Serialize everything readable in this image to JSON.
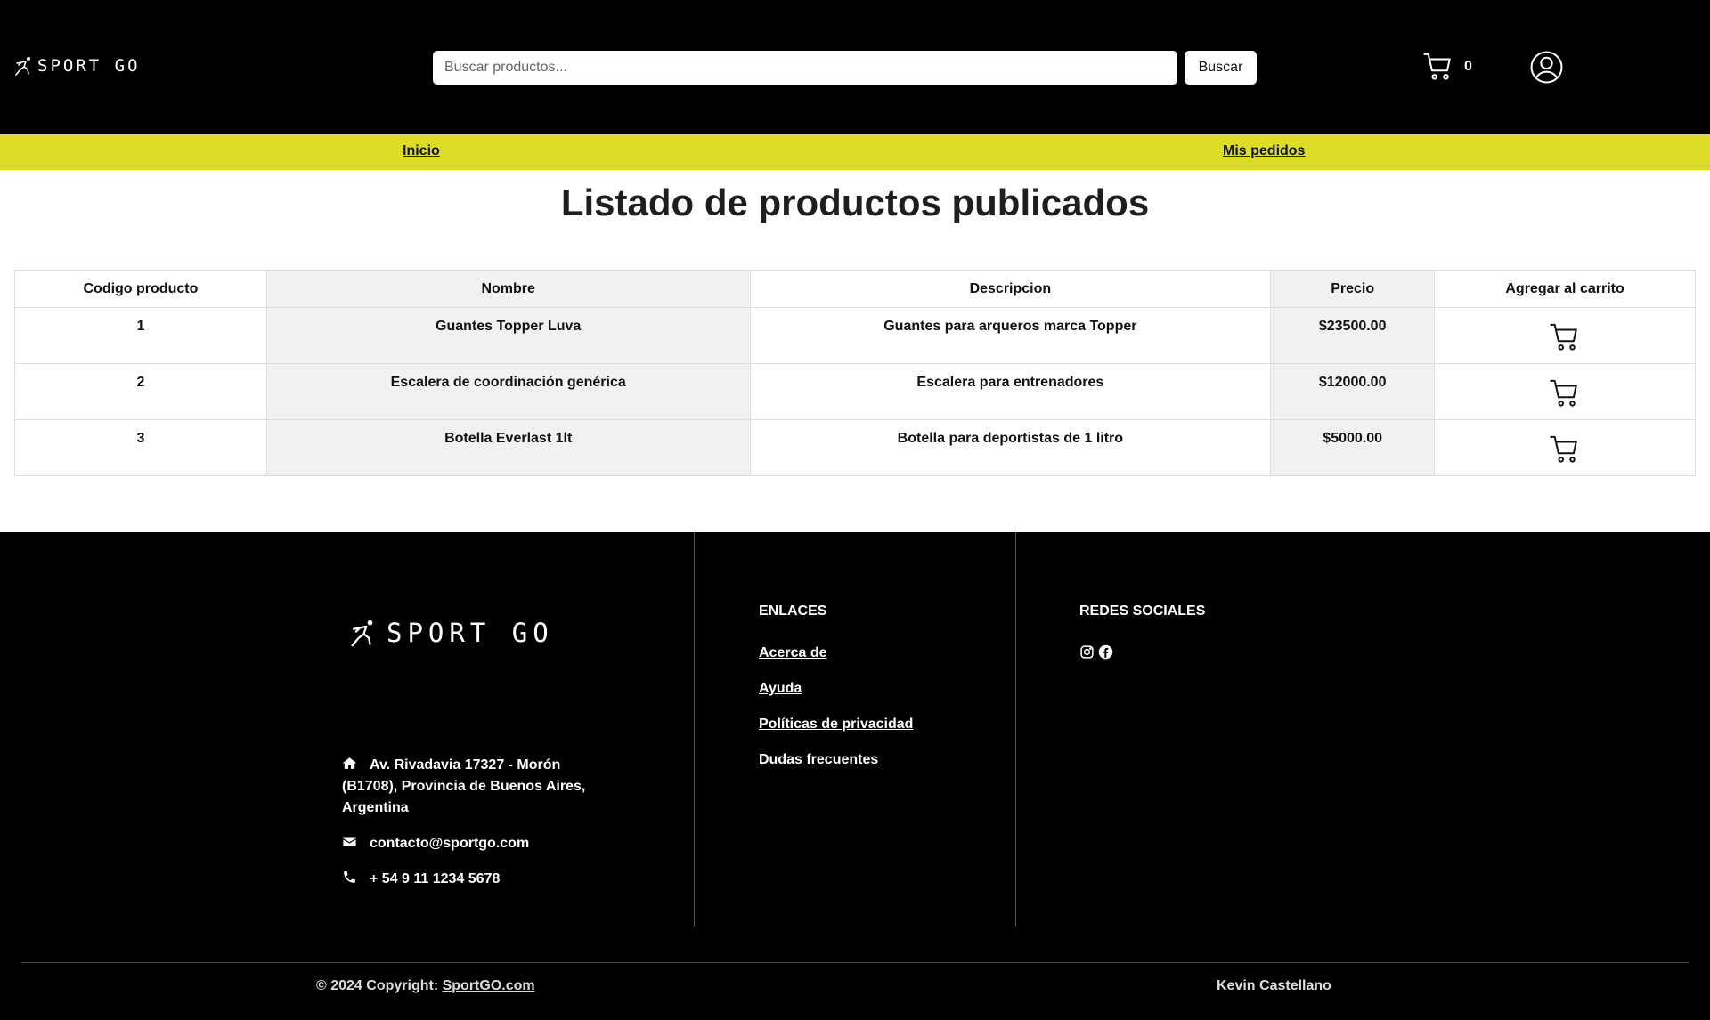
{
  "header": {
    "logo_text": "SPORT GO",
    "search": {
      "placeholder": "Buscar productos...",
      "value": ""
    },
    "search_button": "Buscar",
    "cart_count": "0"
  },
  "nav": {
    "inicio": "Inicio",
    "mis_pedidos": "Mis pedidos"
  },
  "main": {
    "title": "Listado de productos publicados",
    "columns": [
      "Codigo producto",
      "Nombre",
      "Descripcion",
      "Precio",
      "Agregar al carrito"
    ],
    "rows": [
      {
        "codigo": "1",
        "nombre": "Guantes Topper Luva",
        "descripcion": "Guantes para arqueros marca Topper",
        "precio": "$23500.00"
      },
      {
        "codigo": "2",
        "nombre": "Escalera de coordinación genérica",
        "descripcion": "Escalera para entrenadores",
        "precio": "$12000.00"
      },
      {
        "codigo": "3",
        "nombre": "Botella Everlast 1lt",
        "descripcion": "Botella para deportistas de 1 litro",
        "precio": "$5000.00"
      }
    ]
  },
  "footer": {
    "logo_text": "SPORT GO",
    "address": "Av. Rivadavia 17327 - Morón (B1708), Provincia de Buenos Aires, Argentina",
    "email": "contacto@sportgo.com",
    "phone": "+ 54 9 11 1234 5678",
    "enlaces_heading": "ENLACES",
    "links": [
      "Acerca de",
      "Ayuda",
      "Políticas de privacidad",
      "Dudas frecuentes"
    ],
    "redes_heading": "REDES SOCIALES",
    "copyright_prefix": "© 2024 Copyright:",
    "copyright_link": "SportGO.com",
    "author": "Kevin Castellano"
  },
  "colors": {
    "header_bg": "#000000",
    "nav_bg": "#dcdd26",
    "footer_bg": "#000000",
    "table_shade": "#f1f1f1"
  },
  "icons": [
    "runner-logo-icon",
    "cart-icon",
    "user-circle-icon",
    "home-icon",
    "envelope-icon",
    "phone-icon",
    "instagram-icon",
    "facebook-icon"
  ]
}
